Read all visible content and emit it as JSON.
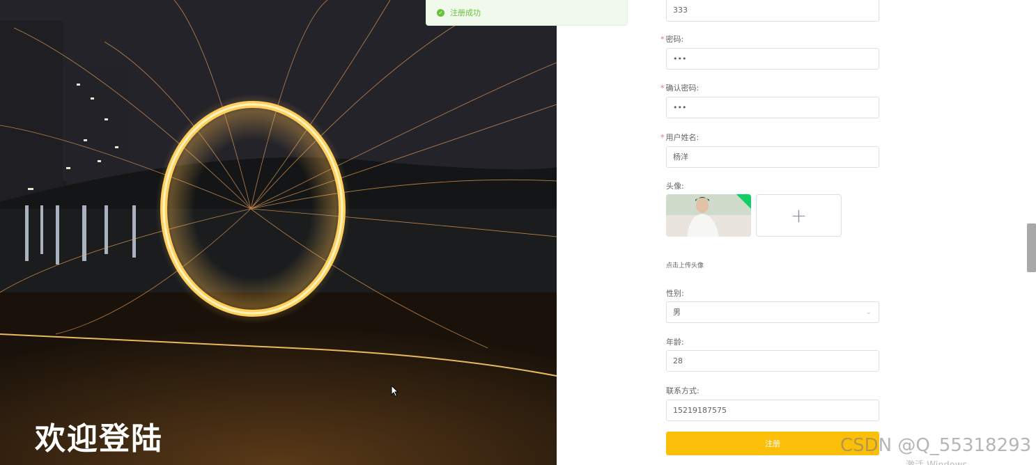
{
  "toast": {
    "message": "注册成功"
  },
  "hero": {
    "title": "欢迎登陆"
  },
  "form": {
    "username_value": "333",
    "password_label": "密码:",
    "password_value": "•••",
    "confirm_label": "确认密码:",
    "confirm_value": "•••",
    "realname_label": "用户姓名:",
    "realname_value": "杨洋",
    "avatar_label": "头像:",
    "upload_plus": "+",
    "upload_tip": "点击上传头像",
    "gender_label": "性别:",
    "gender_value": "男",
    "age_label": "年龄:",
    "age_value": "28",
    "contact_label": "联系方式:",
    "contact_value": "15219187575",
    "submit_label": "注册",
    "required_mark": "*"
  },
  "watermark": {
    "csdn": "CSDN @Q_55318293",
    "windows": "激活 Windows"
  },
  "colors": {
    "primary_button": "#fbbf0a",
    "success": "#67c23a",
    "required": "#f56c6c"
  }
}
